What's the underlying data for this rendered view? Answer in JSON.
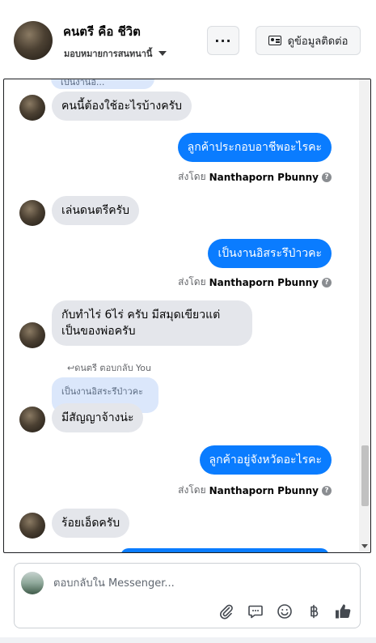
{
  "header": {
    "name": "คนตรี คือ ชีวิต",
    "assign_label": "มอบหมายการสนทนานี้",
    "more_label": "···",
    "contact_label": "ดูข้อมูลติดต่อ"
  },
  "messages": {
    "top_quote": "เป็นงานอิ...",
    "m1": "คนนี้ต้องใช้อะไรบ้างครับ",
    "m2": "ลูกค้าประกอบอาชีพอะไรคะ",
    "m3": "เล่นดนตรีครับ",
    "m4": "เป็นงานอิสระรึป่าวคะ",
    "m5_line1": "กับทำไร่ 6ไร่ ครับ มีสมุดเขียวแต่",
    "m5_line2": "เป็นของพ่อครับ",
    "reply_meta": "ดนตรี ตอบกลับ You",
    "quote": "เป็นงานอิสระรึป่าวคะ",
    "m6": "มีสัญญาจ้างน่ะ",
    "m7": "ลูกค้าอยู่จังหวัดอะไรคะ",
    "m8": "ร้อยเอ็ดครับ"
  },
  "sentby": {
    "prefix": "ส่งโดย",
    "agent": "Nanthaporn Pbunny",
    "help": "?"
  },
  "composer": {
    "placeholder": "ตอบกลับใน Messenger..."
  },
  "icons": [
    "more-icon",
    "contact-card-icon",
    "caret-down-icon",
    "attach-icon",
    "saved-reply-icon",
    "emoji-icon",
    "baht-icon",
    "like-icon"
  ],
  "colors": {
    "outgoing_bubble": "#0a7cff",
    "incoming_bubble": "#e4e6eb",
    "quote_bubble": "#dbe7fb"
  }
}
